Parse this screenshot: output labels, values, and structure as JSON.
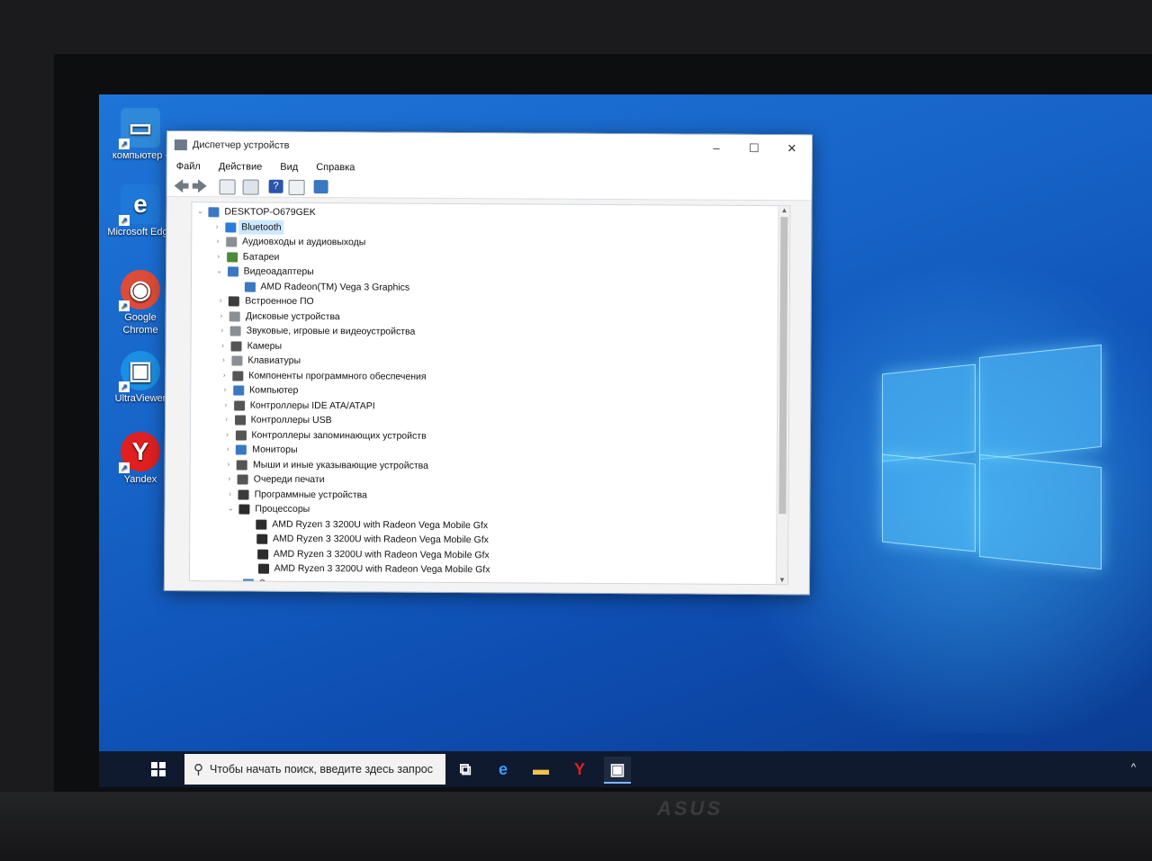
{
  "desktop": {
    "icons": [
      {
        "label": "компьютер -",
        "icon": "computer-icon",
        "color": "#2f88d8"
      },
      {
        "label": "Microsoft Edge",
        "icon": "edge-icon",
        "color": "#1e78d7"
      },
      {
        "label": "Google Chrome",
        "icon": "chrome-icon",
        "color": "#dd4b39"
      },
      {
        "label": "UltraViewer",
        "icon": "ultraviewer-icon",
        "color": "#1a8fe3"
      },
      {
        "label": "Yandex",
        "icon": "yandex-icon",
        "color": "#e02020"
      }
    ]
  },
  "window": {
    "title": "Диспетчер устройств",
    "controls": {
      "minimize": "–",
      "maximize": "☐",
      "close": "✕"
    },
    "menu": [
      "Файл",
      "Действие",
      "Вид",
      "Справка"
    ],
    "toolbar_icons": [
      "back-icon",
      "forward-icon",
      "properties-icon",
      "view-icon",
      "help-icon",
      "details-icon",
      "monitor-icon"
    ]
  },
  "tree": {
    "root": "DESKTOP-O679GEK",
    "items": [
      {
        "label": "Bluetooth",
        "expanded": false,
        "selected": true,
        "icon": "bluetooth-icon",
        "color": "#2b7bd8"
      },
      {
        "label": "Аудиовходы и аудиовыходы",
        "expanded": false,
        "icon": "audio-io-icon",
        "color": "#8a8f96"
      },
      {
        "label": "Батареи",
        "expanded": false,
        "icon": "battery-icon",
        "color": "#4a8a3a"
      },
      {
        "label": "Видеоадаптеры",
        "expanded": true,
        "icon": "display-adapter-icon",
        "color": "#3a78c2",
        "children": [
          "AMD Radeon(TM) Vega 3 Graphics"
        ]
      },
      {
        "label": "Встроенное ПО",
        "expanded": false,
        "icon": "firmware-icon",
        "color": "#3c3c3c"
      },
      {
        "label": "Дисковые устройства",
        "expanded": false,
        "icon": "disk-icon",
        "color": "#8a8f96"
      },
      {
        "label": "Звуковые, игровые и видеоустройства",
        "expanded": false,
        "icon": "sound-icon",
        "color": "#8a8f96"
      },
      {
        "label": "Камеры",
        "expanded": false,
        "icon": "camera-icon",
        "color": "#555"
      },
      {
        "label": "Клавиатуры",
        "expanded": false,
        "icon": "keyboard-icon",
        "color": "#8a8f96"
      },
      {
        "label": "Компоненты программного обеспечения",
        "expanded": false,
        "icon": "software-component-icon",
        "color": "#555"
      },
      {
        "label": "Компьютер",
        "expanded": false,
        "icon": "computer-icon",
        "color": "#3a78c2"
      },
      {
        "label": "Контроллеры IDE ATA/ATAPI",
        "expanded": false,
        "icon": "ide-icon",
        "color": "#555"
      },
      {
        "label": "Контроллеры USB",
        "expanded": false,
        "icon": "usb-icon",
        "color": "#555"
      },
      {
        "label": "Контроллеры запоминающих устройств",
        "expanded": false,
        "icon": "storage-controller-icon",
        "color": "#555"
      },
      {
        "label": "Мониторы",
        "expanded": false,
        "icon": "monitor-icon",
        "color": "#3a78c2"
      },
      {
        "label": "Мыши и иные указывающие устройства",
        "expanded": false,
        "icon": "mouse-icon",
        "color": "#555"
      },
      {
        "label": "Очереди печати",
        "expanded": false,
        "icon": "printer-icon",
        "color": "#555"
      },
      {
        "label": "Программные устройства",
        "expanded": false,
        "icon": "software-device-icon",
        "color": "#3c3c3c"
      },
      {
        "label": "Процессоры",
        "expanded": true,
        "icon": "processor-icon",
        "color": "#2c2c2c",
        "children": [
          "AMD Ryzen 3 3200U with Radeon Vega Mobile Gfx",
          "AMD Ryzen 3 3200U with Radeon Vega Mobile Gfx",
          "AMD Ryzen 3 3200U with Radeon Vega Mobile Gfx",
          "AMD Ryzen 3 3200U with Radeon Vega Mobile Gfx"
        ]
      },
      {
        "label": "Сетевые адаптеры",
        "expanded": false,
        "icon": "network-adapter-icon",
        "color": "#3a78c2"
      }
    ]
  },
  "taskbar": {
    "search_placeholder": "Чтобы начать поиск, введите здесь запрос",
    "pinned": [
      {
        "icon": "task-view-icon",
        "glyph": "⧉"
      },
      {
        "icon": "edge-icon",
        "glyph": "e"
      },
      {
        "icon": "file-explorer-icon",
        "glyph": "▬"
      },
      {
        "icon": "yandex-icon",
        "glyph": "Y"
      },
      {
        "icon": "device-manager-icon",
        "glyph": "▣",
        "active": true
      }
    ],
    "tray": "^"
  },
  "colors": {
    "accent": "#0078d7",
    "selection": "#cce8ff",
    "taskbar": "#0f1a2e"
  }
}
